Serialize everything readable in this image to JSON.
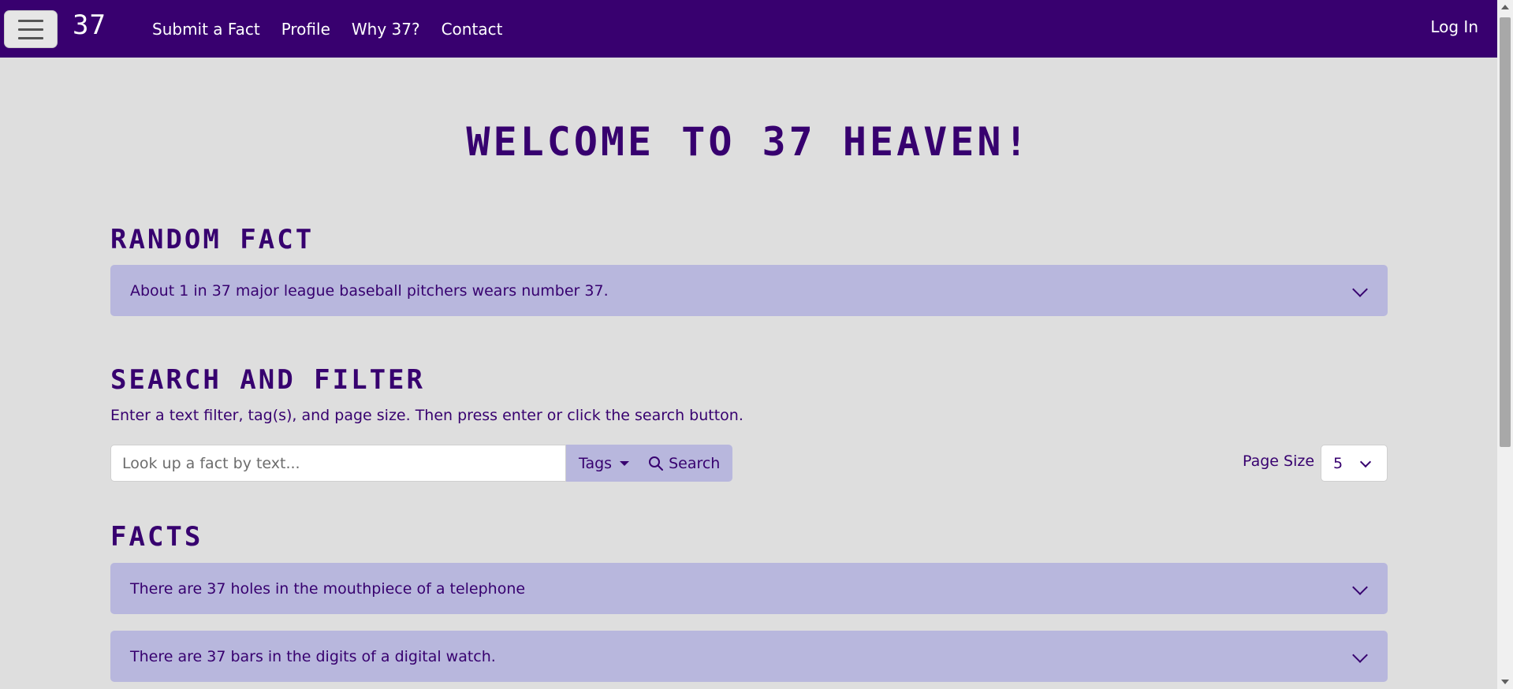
{
  "navbar": {
    "logo_text": "37",
    "links": [
      "Submit a Fact",
      "Profile",
      "Why 37?",
      "Contact"
    ],
    "login_label": "Log In",
    "background": "#38006f"
  },
  "hero": {
    "title": "Welcome to 37 Heaven!"
  },
  "random_fact": {
    "heading": "Random Fact",
    "text": "About 1 in 37 major league baseball pitchers wears number 37."
  },
  "search": {
    "heading": "Search and Filter",
    "instructions": "Enter a text filter, tag(s), and page size. Then press enter or click the search button.",
    "placeholder": "Look up a fact by text...",
    "tags_label": "Tags",
    "search_label": "Search",
    "page_size_label": "Page Size",
    "page_size_value": "5"
  },
  "facts": {
    "heading": "Facts",
    "items": [
      "There are 37 holes in the mouthpiece of a telephone",
      "There are 37 bars in the digits of a digital watch."
    ]
  },
  "colors": {
    "accent": "#37006f",
    "panel": "#b8b7dd",
    "page_background": "#dedede"
  }
}
